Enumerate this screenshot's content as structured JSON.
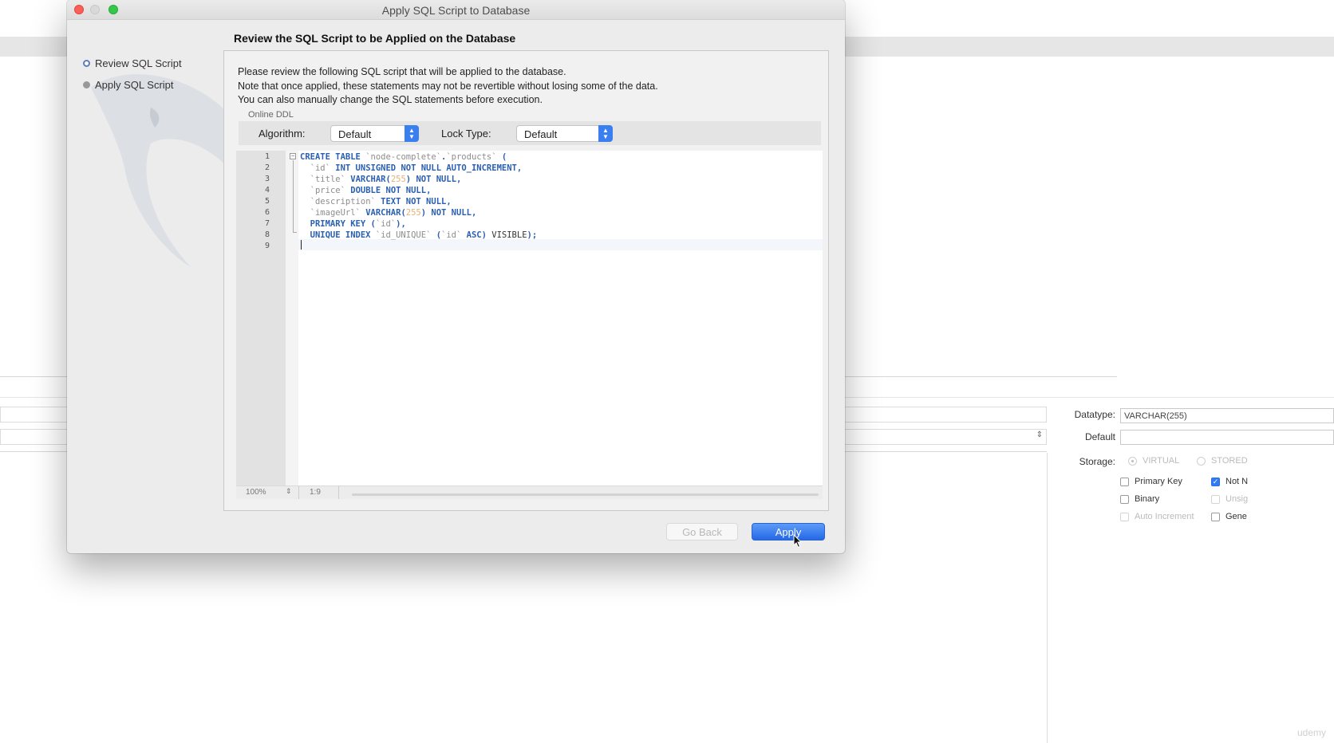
{
  "dialog": {
    "title": "Apply SQL Script to Database",
    "steps": [
      {
        "label": "Review SQL Script",
        "state": "active"
      },
      {
        "label": "Apply SQL Script",
        "state": "pending"
      }
    ],
    "page_title": "Review the SQL Script to be Applied on the Database",
    "info_lines": [
      "Please review the following SQL script that will be applied to the database.",
      "Note that once applied, these statements may not be revertible without losing some of the data.",
      "You can also manually change the SQL statements before execution."
    ],
    "online_ddl": {
      "group_label": "Online DDL",
      "algorithm_label": "Algorithm:",
      "algorithm_value": "Default",
      "lock_type_label": "Lock Type:",
      "lock_type_value": "Default"
    },
    "editor": {
      "line_numbers": [
        "1",
        "2",
        "3",
        "4",
        "5",
        "6",
        "7",
        "8",
        "9"
      ],
      "lines": [
        "CREATE TABLE `node-complete`.`products` (",
        "  `id` INT UNSIGNED NOT NULL AUTO_INCREMENT,",
        "  `title` VARCHAR(255) NOT NULL,",
        "  `price` DOUBLE NOT NULL,",
        "  `description` TEXT NOT NULL,",
        "  `imageUrl` VARCHAR(255) NOT NULL,",
        "  PRIMARY KEY (`id`),",
        "  UNIQUE INDEX `id_UNIQUE` (`id` ASC) VISIBLE);",
        ""
      ],
      "zoom": "100%",
      "cursor_position": "1:9"
    },
    "buttons": {
      "back": "Go Back",
      "apply": "Apply"
    }
  },
  "background": {
    "datatype_label": "Datatype:",
    "datatype_value": "VARCHAR(255)",
    "default_label": "Default",
    "default_value": "",
    "storage_label": "Storage:",
    "storage_virtual": "VIRTUAL",
    "storage_stored": "STORED",
    "primary_key": "Primary Key",
    "binary": "Binary",
    "auto_increment": "Auto Increment",
    "not_null": "Not N",
    "unsigned": "Unsig",
    "generated": "Gene",
    "watermark": "udemy"
  },
  "colors": {
    "accent": "#2f7cf6",
    "sql_keyword": "#2b5fb0",
    "sql_string": "#8d8d8d",
    "sql_number": "#e2b37a"
  }
}
